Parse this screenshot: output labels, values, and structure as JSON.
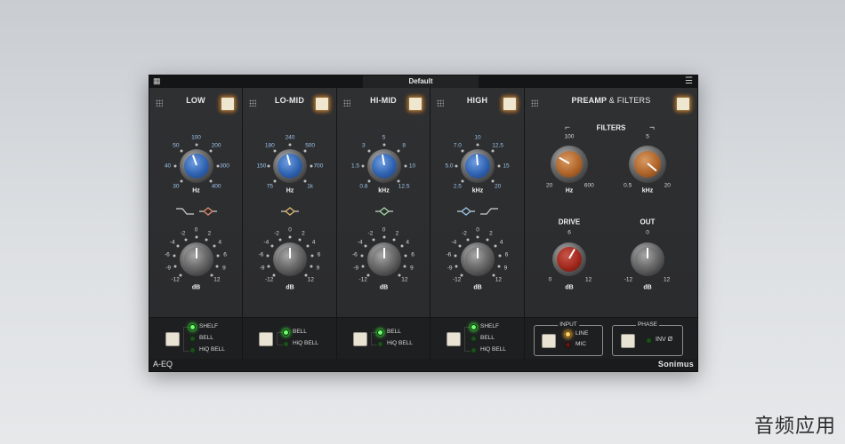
{
  "title_bar": {
    "preset": "Default"
  },
  "bands": [
    {
      "name": "LOW",
      "freq": {
        "labels": [
          "100",
          "50",
          "200",
          "40",
          "300",
          "30",
          "400"
        ],
        "unit": "Hz"
      },
      "gain": {
        "labels": [
          "0",
          "-2",
          "2",
          "-4",
          "4",
          "-6",
          "6",
          "-9",
          "9",
          "-12",
          "12"
        ],
        "unit": "dB"
      },
      "modes": [
        "SHELF",
        "BELL",
        "HiQ BELL"
      ],
      "active_mode": "SHELF"
    },
    {
      "name": "LO-MID",
      "freq": {
        "labels": [
          "240",
          "180",
          "500",
          "150",
          "700",
          "75",
          "1k"
        ],
        "unit": "Hz"
      },
      "gain": {
        "labels": [
          "0",
          "-2",
          "2",
          "-4",
          "4",
          "-6",
          "6",
          "-9",
          "9",
          "-12",
          "12"
        ],
        "unit": "dB"
      },
      "modes": [
        "BELL",
        "HiQ BELL"
      ],
      "active_mode": "BELL"
    },
    {
      "name": "HI-MID",
      "freq": {
        "labels": [
          "5",
          "3",
          "8",
          "1.5",
          "10",
          "0.8",
          "12.5"
        ],
        "unit": "kHz"
      },
      "gain": {
        "labels": [
          "0",
          "-2",
          "2",
          "-4",
          "4",
          "-6",
          "6",
          "-9",
          "9",
          "-12",
          "12"
        ],
        "unit": "dB"
      },
      "modes": [
        "BELL",
        "HiQ BELL"
      ],
      "active_mode": "BELL"
    },
    {
      "name": "HIGH",
      "freq": {
        "labels": [
          "10",
          "7.0",
          "12.5",
          "5.0",
          "15",
          "2.5",
          "20"
        ],
        "unit": "kHz"
      },
      "gain": {
        "labels": [
          "0",
          "-2",
          "2",
          "-4",
          "4",
          "-6",
          "6",
          "-9",
          "9",
          "-12",
          "12"
        ],
        "unit": "dB"
      },
      "modes": [
        "SHELF",
        "BELL",
        "HiQ BELL"
      ],
      "active_mode": "SHELF"
    }
  ],
  "preamp": {
    "title_bold": "PREAMP",
    "title_rest": "& FILTERS",
    "filters_label": "FILTERS",
    "hp": {
      "labels": [
        "100",
        "20",
        "600"
      ],
      "unit": "Hz"
    },
    "lp": {
      "labels": [
        "5",
        "0.5",
        "20"
      ],
      "unit": "kHz"
    },
    "drive": {
      "label": "DRIVE",
      "labels": [
        "6",
        "0",
        "12"
      ],
      "unit": "dB"
    },
    "out": {
      "label": "OUT",
      "labels": [
        "0",
        "-12",
        "12"
      ],
      "unit": "dB"
    },
    "input": {
      "label": "INPUT",
      "options": [
        "LINE",
        "MIC"
      ],
      "active": "LINE"
    },
    "phase": {
      "label": "PHASE",
      "option": "INV Ø"
    }
  },
  "footer": {
    "plugin_logo": "A-EQ",
    "brand": "Sonimus"
  },
  "watermark": "音频应用",
  "colors": {
    "freq_knob": "#2f62b0",
    "filter_knob": "#b0652a",
    "drive_knob": "#a1281d",
    "led_on": "#6dff6d",
    "power": "#efe6cf"
  }
}
